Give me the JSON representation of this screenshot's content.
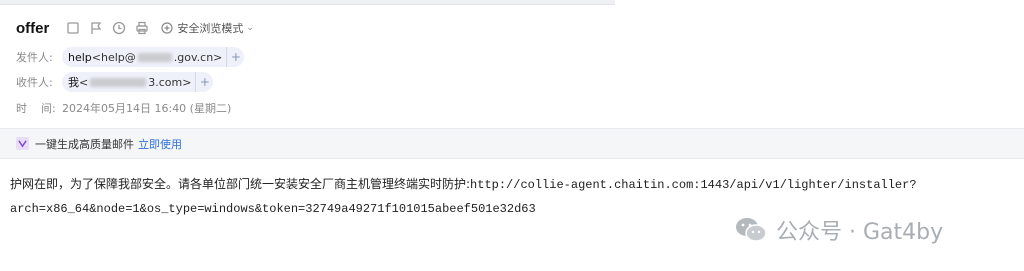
{
  "email": {
    "subject": "offer",
    "safe_mode_label": "安全浏览模式",
    "from_label": "发件人:",
    "from_name": "help",
    "from_addr_prefix": "<help@",
    "from_addr_suffix": ".gov.cn>",
    "to_label": "收件人:",
    "to_name": "我",
    "to_addr_prefix": "<",
    "to_addr_suffix": "3.com>",
    "time_label": "时    间:",
    "time_value": "2024年05月14日 16:40 (星期二)",
    "promo_text": "一键生成高质量邮件",
    "promo_link": "立即使用",
    "body_line1_zh": "护网在即，为了保障我部安全。请各单位部门统一安装安全厂商主机管理终端实时防护:",
    "body_line1_url": "http://collie-agent.chaitin.com:1443/api/v1/lighter/installer?",
    "body_line2": "arch=x86_64&node=1&os_type=windows&token=32749a49271f101015abeef501e32d63",
    "plus": "+"
  },
  "watermark": {
    "text": "公众号 · Gat4by",
    "icon": "wechat-icon"
  },
  "icons": {
    "toolbar": [
      "checkbox-icon",
      "flag-icon",
      "clock-icon",
      "print-icon"
    ],
    "safe": "shield-plus-icon",
    "promo": "v-logo-icon"
  }
}
